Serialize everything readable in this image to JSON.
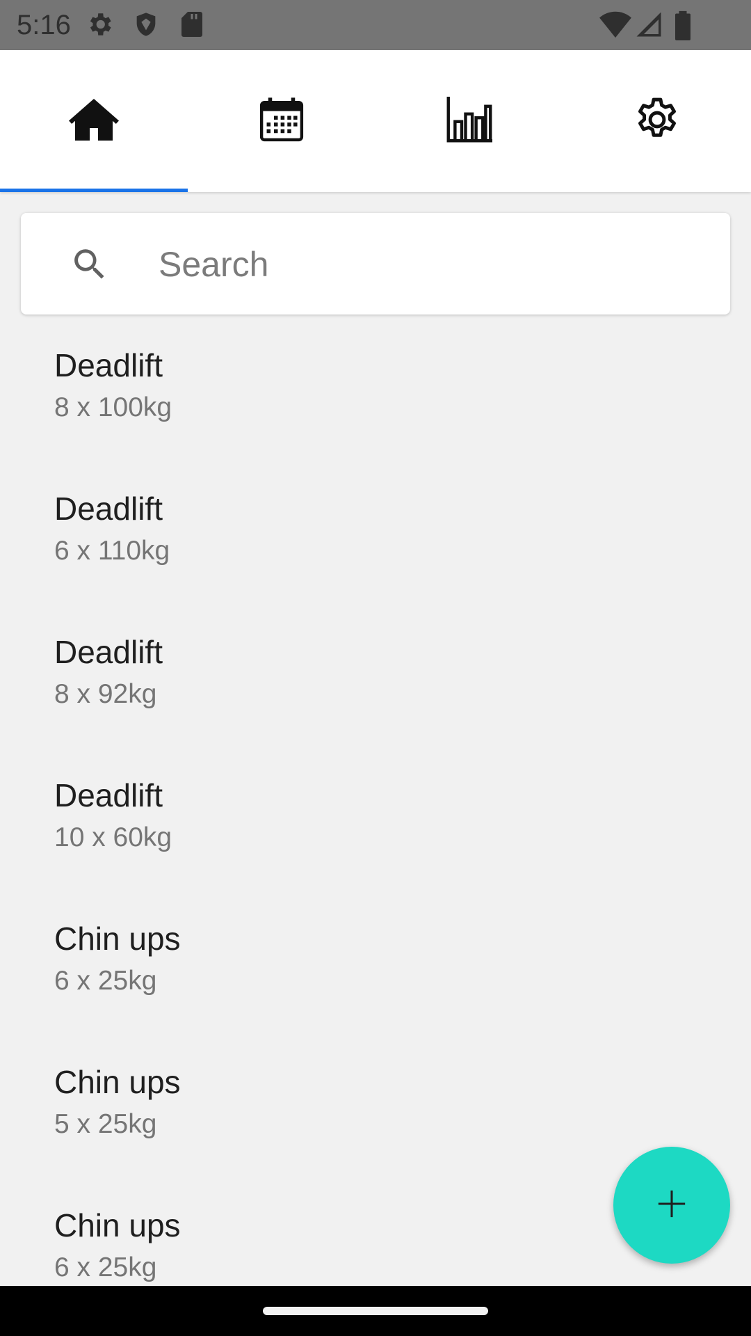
{
  "status_bar": {
    "time": "5:16",
    "icons": [
      "gear-icon",
      "shield-icon",
      "sd-card-icon",
      "wifi-icon",
      "signal-icon",
      "battery-icon"
    ]
  },
  "tabs": [
    {
      "icon": "home-icon",
      "active": true
    },
    {
      "icon": "calendar-icon",
      "active": false
    },
    {
      "icon": "bar-chart-icon",
      "active": false
    },
    {
      "icon": "settings-icon",
      "active": false
    }
  ],
  "search": {
    "placeholder": "Search",
    "value": ""
  },
  "list": {
    "items": [
      {
        "title": "Deadlift",
        "subtitle": "8 x 100kg"
      },
      {
        "title": "Deadlift",
        "subtitle": "6 x 110kg"
      },
      {
        "title": "Deadlift",
        "subtitle": "8 x 92kg"
      },
      {
        "title": "Deadlift",
        "subtitle": "10 x 60kg"
      },
      {
        "title": "Chin ups",
        "subtitle": "6 x 25kg"
      },
      {
        "title": "Chin ups",
        "subtitle": "5 x 25kg"
      },
      {
        "title": "Chin ups",
        "subtitle": "6 x 25kg"
      }
    ]
  },
  "fab": {
    "icon": "plus-icon"
  },
  "colors": {
    "accent": "#1a73e8",
    "fab": "#1dd9c3",
    "status_bar": "#757575",
    "background": "#f1f1f1"
  }
}
